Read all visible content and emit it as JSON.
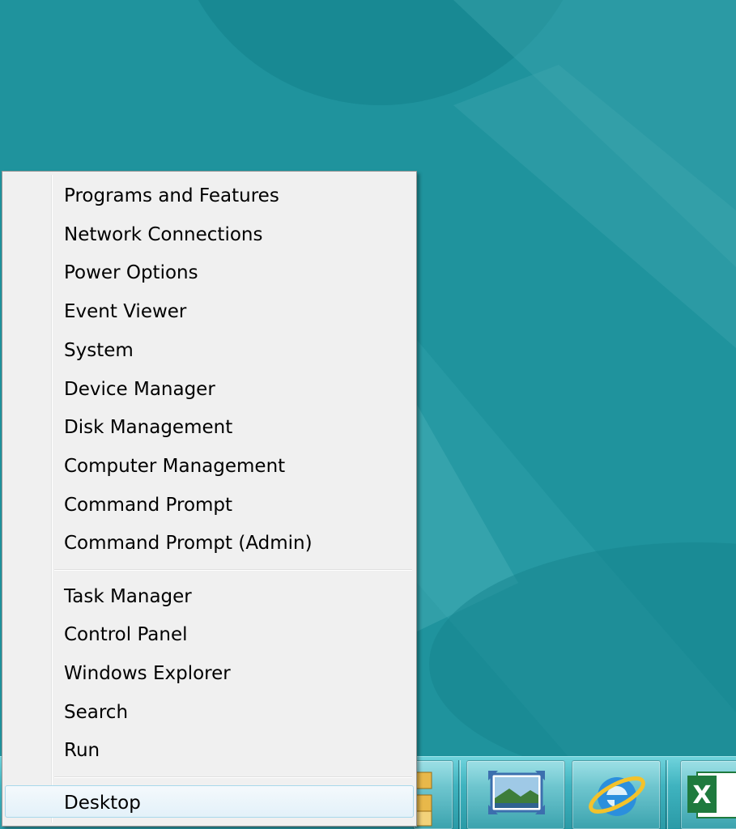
{
  "context_menu": {
    "items": [
      {
        "label": "Programs and Features"
      },
      {
        "label": "Network Connections"
      },
      {
        "label": "Power Options"
      },
      {
        "label": "Event Viewer"
      },
      {
        "label": "System"
      },
      {
        "label": "Device Manager"
      },
      {
        "label": "Disk Management"
      },
      {
        "label": "Computer Management"
      },
      {
        "label": "Command Prompt"
      },
      {
        "label": "Command Prompt (Admin)"
      },
      {
        "label": "Task Manager"
      },
      {
        "label": "Control Panel"
      },
      {
        "label": "Windows Explorer"
      },
      {
        "label": "Search"
      },
      {
        "label": "Run"
      },
      {
        "label": "Desktop",
        "selected": true
      }
    ]
  },
  "taskbar": {
    "apps": [
      {
        "icon": "file-explorer-icon"
      },
      {
        "icon": "photos-icon"
      },
      {
        "icon": "internet-explorer-icon"
      },
      {
        "icon": "excel-icon"
      }
    ]
  },
  "colors": {
    "wallpaper": "#1d8e98",
    "menu_background": "#f0f0f0",
    "selection_border": "#a8d8eb"
  }
}
